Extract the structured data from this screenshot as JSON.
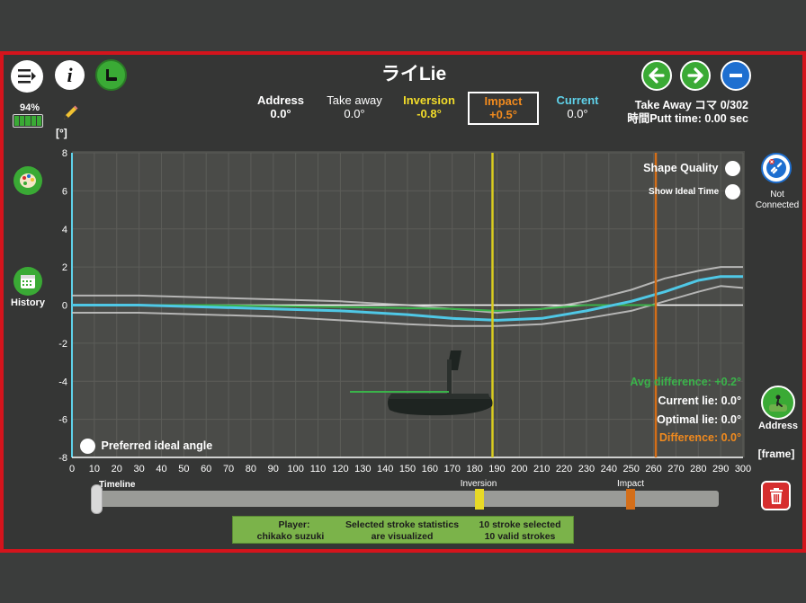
{
  "app": {
    "title": "ライLie",
    "battery": "94%",
    "history_label": "History",
    "not_connected_label": "Not Connected",
    "address_side_label": "Address",
    "frame_unit_label": "[frame]",
    "y_unit_label": "[°]",
    "take_away_koma": "Take Away コマ 0/302",
    "putt_time": "時間Putt time: 0.00 sec"
  },
  "stats": [
    {
      "name": "Address",
      "value": "0.0°",
      "color": "#ffffff"
    },
    {
      "name": "Take away",
      "value": "0.0°",
      "color": "#ffffff"
    },
    {
      "name": "Inversion",
      "value": "-0.8°",
      "color": "#f2dc2a"
    },
    {
      "name": "Impact",
      "value": "+0.5°",
      "color": "#f08a1e"
    },
    {
      "name": "Current",
      "value": "0.0°",
      "color": "#5fd2ea"
    }
  ],
  "chart_toggles": {
    "shape_quality": "Shape Quality",
    "show_ideal_time": "Show Ideal Time",
    "preferred_ideal_angle": "Preferred ideal angle"
  },
  "readouts": {
    "avg_difference": "Avg difference: +0.2°",
    "current_lie": "Current lie: 0.0°",
    "optimal_lie": "Optimal lie: 0.0°",
    "difference": "Difference: 0.0°"
  },
  "timeline": {
    "label": "Timeline",
    "inversion_label": "Inversion",
    "impact_label": "Impact",
    "inversion_frame": 188,
    "impact_frame": 261
  },
  "info_bar": {
    "player_label": "Player:",
    "player_name": "chikako suzuki",
    "stats_line1": "Selected stroke statistics",
    "stats_line2": "are visualized",
    "count_line1": "10 stroke selected",
    "count_line2": "10 valid strokes"
  },
  "colors": {
    "frame_red": "#d4141c",
    "green_btn": "#3aaa35",
    "blue_btn": "#1e6fd0",
    "inversion": "#d9cc1f",
    "impact": "#d46e18",
    "current": "#4fc8e6",
    "ideal": "#3ab34a"
  },
  "chart_data": {
    "type": "line",
    "x_ticks": [
      0,
      10,
      20,
      30,
      40,
      50,
      60,
      70,
      80,
      90,
      100,
      110,
      120,
      130,
      140,
      150,
      160,
      170,
      180,
      190,
      200,
      210,
      220,
      230,
      240,
      250,
      260,
      270,
      280,
      290,
      300
    ],
    "y_ticks": [
      8,
      6,
      4,
      2,
      0,
      -2,
      -4,
      -6,
      -8
    ],
    "xlim": [
      0,
      300
    ],
    "ylim": [
      -8,
      8
    ],
    "vlines": [
      {
        "name": "Inversion",
        "x": 188
      },
      {
        "name": "Impact",
        "x": 261
      }
    ],
    "series": [
      {
        "role": "mean",
        "color": "#4fc8e6",
        "x": [
          0,
          30,
          60,
          90,
          120,
          150,
          170,
          190,
          210,
          230,
          250,
          265,
          280,
          290,
          300
        ],
        "y": [
          0.0,
          0.0,
          -0.1,
          -0.2,
          -0.3,
          -0.5,
          -0.7,
          -0.8,
          -0.7,
          -0.3,
          0.2,
          0.7,
          1.3,
          1.5,
          1.5
        ]
      },
      {
        "role": "upper",
        "color": "#c8c8c8",
        "x": [
          0,
          30,
          60,
          90,
          120,
          150,
          170,
          190,
          210,
          230,
          250,
          265,
          280,
          290,
          300
        ],
        "y": [
          0.5,
          0.5,
          0.4,
          0.3,
          0.2,
          0.0,
          -0.2,
          -0.4,
          -0.2,
          0.2,
          0.8,
          1.4,
          1.8,
          2.0,
          2.0
        ]
      },
      {
        "role": "lower",
        "color": "#c8c8c8",
        "x": [
          0,
          30,
          60,
          90,
          120,
          150,
          170,
          190,
          210,
          230,
          250,
          265,
          280,
          290,
          300
        ],
        "y": [
          -0.4,
          -0.4,
          -0.5,
          -0.6,
          -0.8,
          -1.0,
          -1.1,
          -1.1,
          -1.0,
          -0.7,
          -0.3,
          0.2,
          0.7,
          1.0,
          0.9
        ]
      },
      {
        "role": "ideal",
        "color": "#3ab34a",
        "x": [
          0,
          60,
          120,
          170,
          190,
          210,
          230,
          250,
          261
        ],
        "y": [
          0.0,
          0.0,
          -0.1,
          -0.2,
          -0.3,
          -0.2,
          0.0,
          0.0,
          0.0
        ]
      },
      {
        "role": "zero-line",
        "color": "#ffffff",
        "x": [
          0,
          300
        ],
        "y": [
          0,
          0
        ]
      }
    ]
  }
}
